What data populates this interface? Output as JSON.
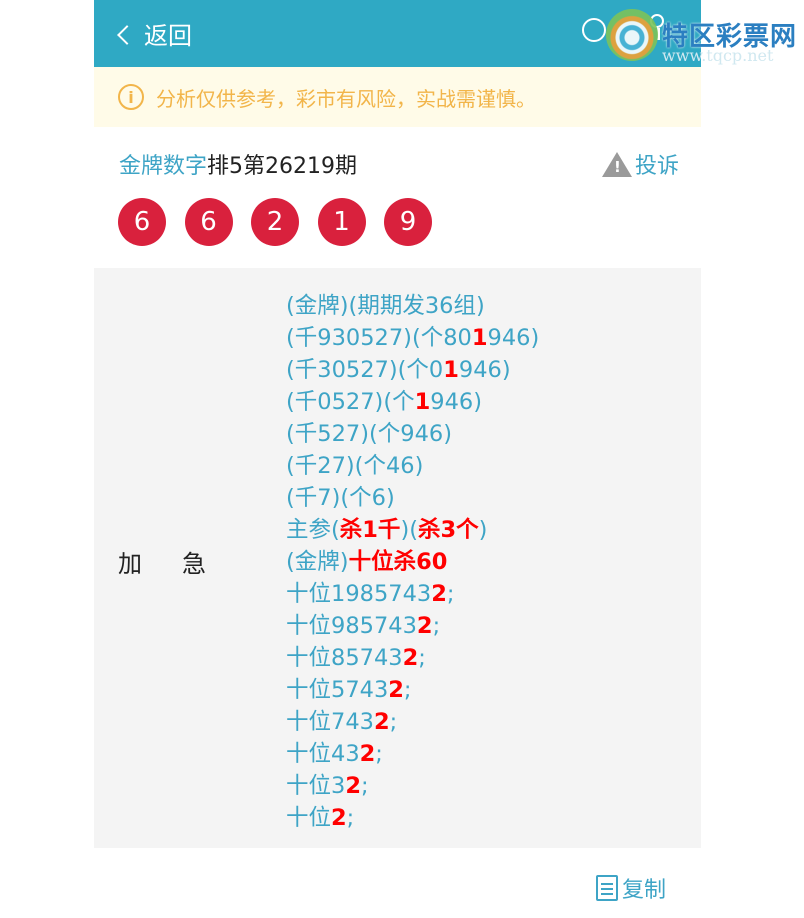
{
  "header": {
    "back_label": "返回"
  },
  "watermark": {
    "title": "特区彩票网",
    "url": "www.tqcp.net"
  },
  "notice": {
    "text": "分析仅供参考，彩市有风险，实战需谨慎。"
  },
  "post": {
    "author": "金牌数字",
    "title": "排5第26219期",
    "complain_label": "投诉",
    "numbers": [
      "6",
      "6",
      "2",
      "1",
      "9"
    ]
  },
  "content": {
    "label_chars": [
      "加",
      "急"
    ],
    "lines": [
      [
        {
          "t": "(金牌)(期期发36组)",
          "r": false
        }
      ],
      [
        {
          "t": "(千930527)(个80",
          "r": false
        },
        {
          "t": "1",
          "r": true
        },
        {
          "t": "946)",
          "r": false
        }
      ],
      [
        {
          "t": "(千30527)(个0",
          "r": false
        },
        {
          "t": "1",
          "r": true
        },
        {
          "t": "946)",
          "r": false
        }
      ],
      [
        {
          "t": "(千0527)(个",
          "r": false
        },
        {
          "t": "1",
          "r": true
        },
        {
          "t": "946)",
          "r": false
        }
      ],
      [
        {
          "t": "(千527)(个946)",
          "r": false
        }
      ],
      [
        {
          "t": "(千27)(个46)",
          "r": false
        }
      ],
      [
        {
          "t": "(千7)(个6)",
          "r": false
        }
      ],
      [
        {
          "t": "主参(",
          "r": false
        },
        {
          "t": "杀1千",
          "r": true
        },
        {
          "t": ")(",
          "r": false
        },
        {
          "t": "杀3个",
          "r": true
        },
        {
          "t": ")",
          "r": false
        }
      ],
      [
        {
          "t": "(金牌)",
          "r": false
        },
        {
          "t": "十位杀60",
          "r": true
        }
      ],
      [
        {
          "t": "十位1985743",
          "r": false
        },
        {
          "t": "2",
          "r": true
        },
        {
          "t": ";",
          "r": false
        }
      ],
      [
        {
          "t": "十位985743",
          "r": false
        },
        {
          "t": "2",
          "r": true
        },
        {
          "t": ";",
          "r": false
        }
      ],
      [
        {
          "t": "十位85743",
          "r": false
        },
        {
          "t": "2",
          "r": true
        },
        {
          "t": ";",
          "r": false
        }
      ],
      [
        {
          "t": "十位5743",
          "r": false
        },
        {
          "t": "2",
          "r": true
        },
        {
          "t": ";",
          "r": false
        }
      ],
      [
        {
          "t": "十位743",
          "r": false
        },
        {
          "t": "2",
          "r": true
        },
        {
          "t": ";",
          "r": false
        }
      ],
      [
        {
          "t": "十位43",
          "r": false
        },
        {
          "t": "2",
          "r": true
        },
        {
          "t": ";",
          "r": false
        }
      ],
      [
        {
          "t": "十位3",
          "r": false
        },
        {
          "t": "2",
          "r": true
        },
        {
          "t": ";",
          "r": false
        }
      ],
      [
        {
          "t": "十位",
          "r": false
        },
        {
          "t": "2",
          "r": true
        },
        {
          "t": ";",
          "r": false
        }
      ]
    ]
  },
  "actions": {
    "copy_label": "复制"
  },
  "colors": {
    "header_bg": "#2fa9c4",
    "accent": "#3ea4c6",
    "ball": "#d9213d",
    "highlight": "#ff0000",
    "notice_text": "#f2b54a"
  }
}
